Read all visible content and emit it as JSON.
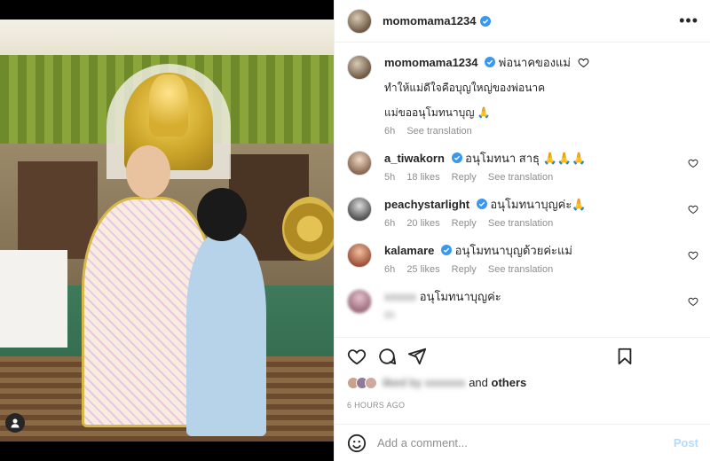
{
  "post": {
    "username": "momomama1234",
    "verified": true,
    "caption_title": "พ่อนาคของแม่",
    "caption_lines": [
      "ทำให้แม่ดีใจคือบุญใหญ่ของพ่อนาค",
      "แม่ขออนุโมทนาบุญ 🙏"
    ],
    "caption_time": "6h",
    "see_translation": "See translation"
  },
  "comments": [
    {
      "username": "a_tiwakorn",
      "text": "อนุโมทนา สาธุ 🙏🙏🙏",
      "time": "5h",
      "likes": "18 likes",
      "reply": "Reply",
      "translate": "See translation"
    },
    {
      "username": "peachystarlight",
      "text": "อนุโมทนาบุญค่ะ🙏",
      "time": "6h",
      "likes": "20 likes",
      "reply": "Reply",
      "translate": "See translation"
    },
    {
      "username": "kalamare",
      "text": "อนุโมทนาบุญด้วยค่ะแม่",
      "time": "6h",
      "likes": "25 likes",
      "reply": "Reply",
      "translate": "See translation"
    },
    {
      "username": "xxxxx",
      "text": "อนุโมทนาบุญค่ะ",
      "time": "6h",
      "likes": "",
      "reply": "",
      "translate": ""
    }
  ],
  "likes": {
    "liked_by": "liked by xxxxxxx",
    "and_others": "and",
    "others_word": "others"
  },
  "time_ago": "6 HOURS AGO",
  "add_comment": {
    "placeholder": "Add a comment...",
    "post_label": "Post"
  },
  "colors": {
    "verified": "#3897f0",
    "post_disabled": "#b3dbff",
    "meta": "#8e8e8e"
  },
  "icons": [
    "more-options-icon",
    "heart-icon",
    "comment-icon",
    "share-icon",
    "save-icon",
    "emoji-icon",
    "user-tag-icon",
    "verified-badge-icon"
  ]
}
